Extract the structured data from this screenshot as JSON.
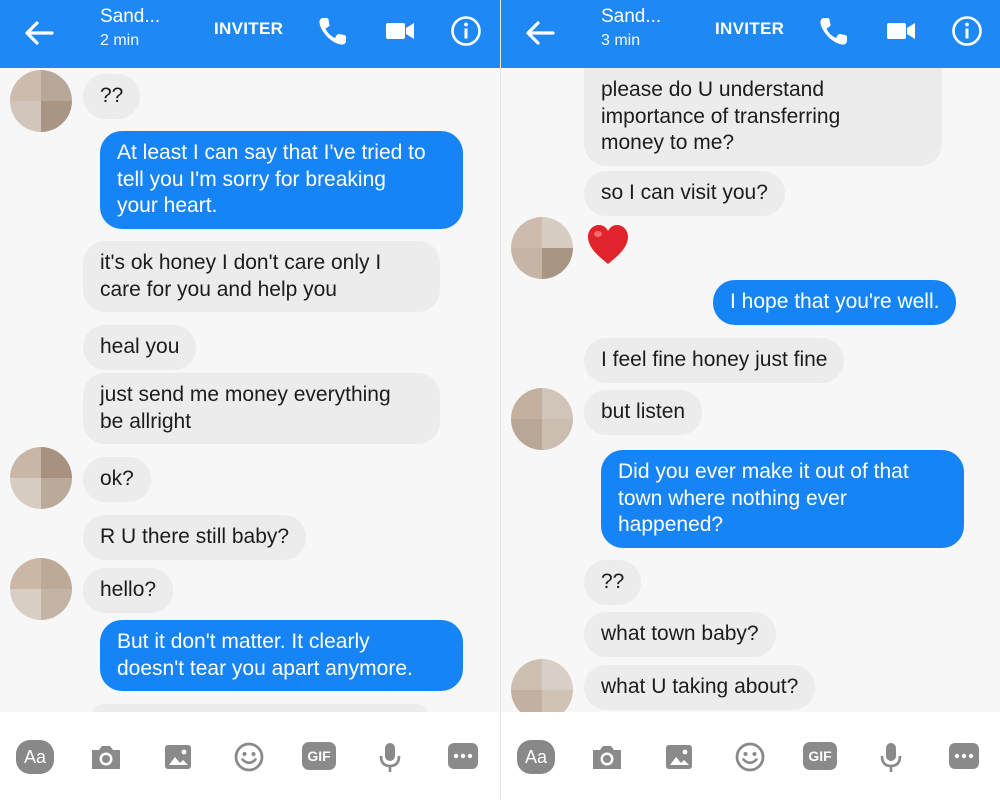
{
  "left": {
    "header": {
      "contact_name": "Sand...",
      "last_active": "2 min",
      "invite_label": "INVITER"
    },
    "messages": [
      {
        "dir": "in",
        "text": "??"
      },
      {
        "dir": "out",
        "text": "At least I can say that I've tried to\ntell you I'm sorry for breaking\nyour heart."
      },
      {
        "dir": "in",
        "text": "it's ok honey I don't care only I\ncare for you and help you"
      },
      {
        "dir": "in",
        "text": "heal you"
      },
      {
        "dir": "in",
        "text": "just send me money everything\nbe allright"
      },
      {
        "dir": "in",
        "text": "ok?"
      },
      {
        "dir": "in",
        "text": "R U there still baby?"
      },
      {
        "dir": "in",
        "text": "hello?"
      },
      {
        "dir": "out",
        "text": "But it don't matter. It clearly\ndoesn't tear you apart anymore."
      }
    ],
    "composer": {
      "text_button": "Aa",
      "gif_label": "GIF"
    }
  },
  "right": {
    "header": {
      "contact_name": "Sand...",
      "last_active": "3 min",
      "invite_label": "INVITER"
    },
    "messages": [
      {
        "dir": "in",
        "text": "please do U understand\nimportance of transferring\nmoney to me?"
      },
      {
        "dir": "in",
        "text": "so I can visit you?"
      },
      {
        "dir": "in",
        "text": "heart emoji"
      },
      {
        "dir": "out",
        "text": "I hope that you're well."
      },
      {
        "dir": "in",
        "text": "I feel fine honey just fine"
      },
      {
        "dir": "in",
        "text": "but listen"
      },
      {
        "dir": "out",
        "text": "Did you ever make it out of that\ntown where nothing ever\nhappened?"
      },
      {
        "dir": "in",
        "text": "??"
      },
      {
        "dir": "in",
        "text": "what town baby?"
      },
      {
        "dir": "in",
        "text": "what U taking about?"
      }
    ],
    "composer": {
      "text_button": "Aa",
      "gif_label": "GIF"
    }
  },
  "colors": {
    "header_blue": "#1e88f5",
    "outgoing_bubble": "#1684f5",
    "incoming_bubble": "#ececec",
    "heart_red": "#e0242b"
  }
}
